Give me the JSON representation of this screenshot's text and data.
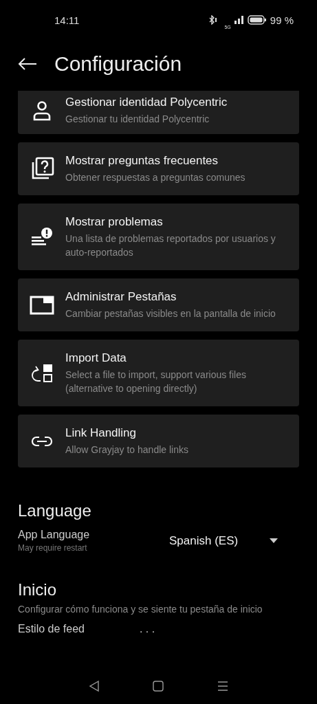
{
  "status_bar": {
    "time": "14:11",
    "network": "5G",
    "battery": "99 %"
  },
  "header": {
    "title": "Configuración"
  },
  "items": [
    {
      "kind": "person",
      "title": "Gestionar identidad Polycentric",
      "subtitle": "Gestionar tu identidad Polycentric"
    },
    {
      "kind": "faq",
      "title": "Mostrar preguntas frecuentes",
      "subtitle": "Obtener respuestas a preguntas comunes"
    },
    {
      "kind": "problems",
      "title": "Mostrar problemas",
      "subtitle": "Una lista de problemas reportados por usuarios y auto-reportados"
    },
    {
      "kind": "tabs",
      "title": "Administrar Pestañas",
      "subtitle": "Cambiar pestañas visibles en la pantalla de inicio"
    },
    {
      "kind": "import",
      "title": "Import Data",
      "subtitle": "Select a file to import, support various files (alternative to opening directly)"
    },
    {
      "kind": "link",
      "title": "Link Handling",
      "subtitle": "Allow Grayjay to handle links"
    }
  ],
  "language": {
    "heading": "Language",
    "label": "App Language",
    "hint": "May require restart",
    "value": "Spanish (ES)"
  },
  "home": {
    "heading": "Inicio",
    "description": "Configurar cómo funciona y se siente tu pestaña de inicio",
    "setting_label": "Estilo de feed",
    "setting_value": ". . ."
  }
}
